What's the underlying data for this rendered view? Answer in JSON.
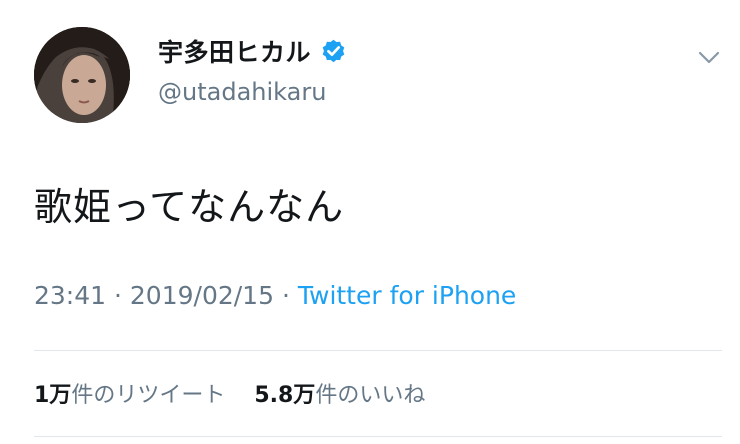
{
  "user": {
    "display_name": "宇多田ヒカル",
    "handle": "@utadahikaru",
    "verified": true
  },
  "tweet": {
    "text": "歌姫ってなんなん",
    "time": "23:41",
    "separator": "·",
    "date": "2019/02/15",
    "source": "Twitter for iPhone"
  },
  "stats": {
    "retweets_count": "1万",
    "retweets_label": "件のリツイート",
    "likes_count": "5.8万",
    "likes_label": "件のいいね"
  },
  "icons": {
    "verified": "verified-badge-icon",
    "menu": "chevron-down-icon"
  },
  "colors": {
    "verified_blue": "#1da1f2",
    "link": "#1da1f2",
    "secondary_text": "#657786",
    "primary_text": "#14171a"
  }
}
